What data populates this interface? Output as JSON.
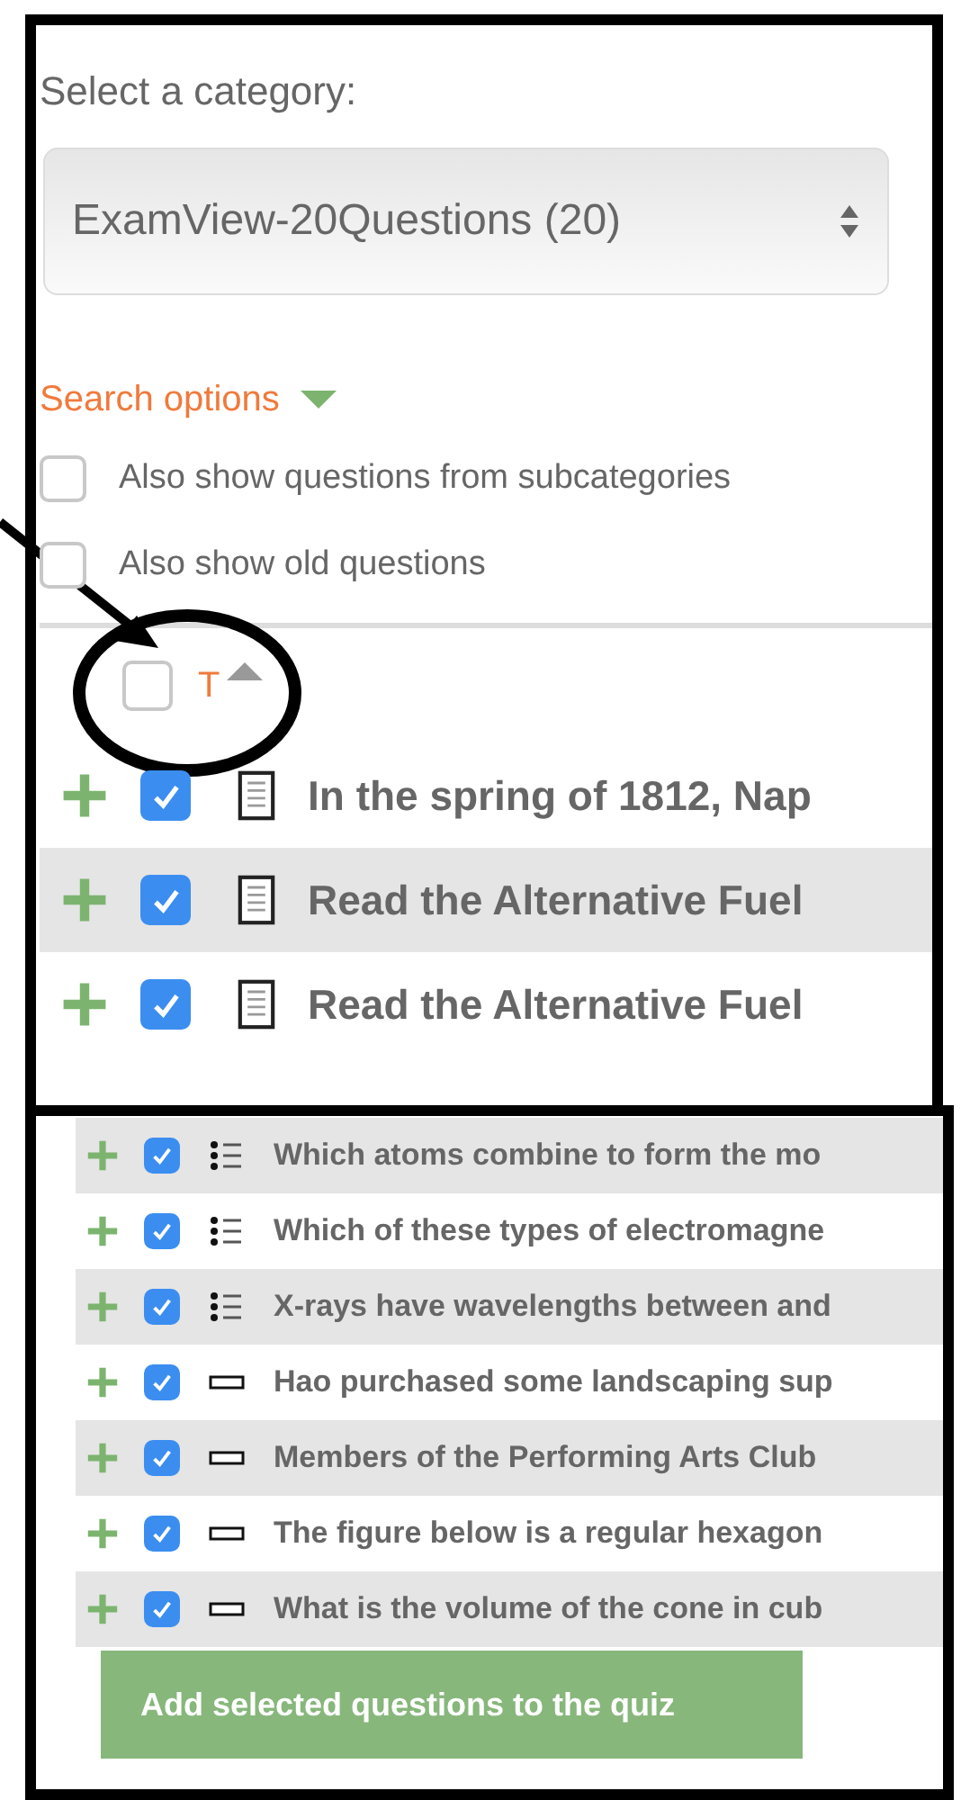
{
  "top_panel": {
    "category_label": "Select a category:",
    "category_select": {
      "value": "ExamView-20Questions (20)"
    },
    "search_options": {
      "label": "Search options",
      "expanded": true
    },
    "options": [
      {
        "label": "Also show questions from subcategories",
        "checked": false
      },
      {
        "label": "Also show old questions",
        "checked": false
      }
    ],
    "header": {
      "checked": false,
      "sort_label": "T"
    },
    "questions": [
      {
        "text": "In the spring of 1812, Nap",
        "checked": true,
        "kind": "essay"
      },
      {
        "text": "Read the Alternative Fuel",
        "checked": true,
        "kind": "essay"
      },
      {
        "text": "Read the Alternative Fuel",
        "checked": true,
        "kind": "essay"
      }
    ]
  },
  "bottom_panel": {
    "questions": [
      {
        "text": "Which atoms combine to form the mo",
        "checked": true,
        "kind": "choice"
      },
      {
        "text": "Which of these types of electromagne",
        "checked": true,
        "kind": "choice"
      },
      {
        "text": "X-rays have wavelengths between and",
        "checked": true,
        "kind": "choice"
      },
      {
        "text": "Hao purchased some landscaping sup",
        "checked": true,
        "kind": "short"
      },
      {
        "text": "Members of the Performing Arts Club",
        "checked": true,
        "kind": "short"
      },
      {
        "text": "The figure below is a regular hexagon",
        "checked": true,
        "kind": "short"
      },
      {
        "text": "What is the volume of the cone in cub",
        "checked": true,
        "kind": "short"
      }
    ],
    "add_button": "Add selected questions to the quiz"
  }
}
